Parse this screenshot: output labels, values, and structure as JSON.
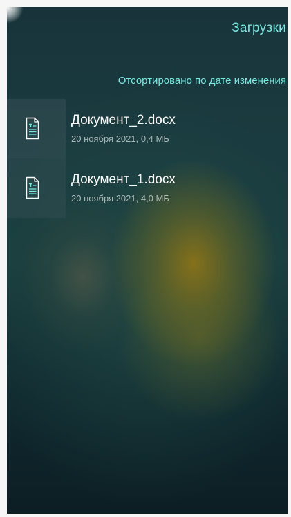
{
  "header": {
    "title": "Загрузки",
    "sort_label": "Отсортировано по дате изменения"
  },
  "files": [
    {
      "name": "Документ_2.docx",
      "meta": "20 ноября 2021, 0,4 МБ",
      "icon": "document-icon"
    },
    {
      "name": "Документ_1.docx",
      "meta": "20 ноября 2021, 4,0 МБ",
      "icon": "document-icon"
    }
  ],
  "colors": {
    "accent": "#76e8e0",
    "text_primary": "#ffffff"
  }
}
